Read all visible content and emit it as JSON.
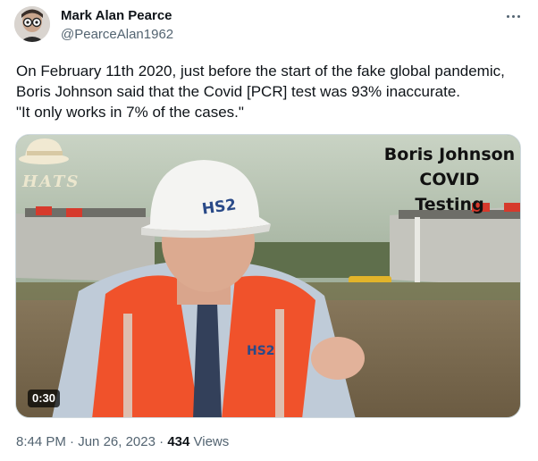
{
  "author": {
    "name": "Mark Alan Pearce",
    "handle": "@PearceAlan1962"
  },
  "tweet": {
    "lines": [
      "On February 11th 2020, just before the start of the fake global pandemic,",
      "Boris Johnson said that the Covid [PCR] test was 93% inaccurate.",
      "\"It only works in 7% of the cases.\""
    ]
  },
  "video": {
    "title_line1": "Boris Johnson",
    "title_line2": "COVID Testing",
    "watermark": "HATS",
    "helmet_text": "HS2",
    "vest_text": "HS2",
    "duration": "0:30"
  },
  "footer": {
    "time": "8:44 PM",
    "date": "Jun 26, 2023",
    "separator": "·",
    "views_count": "434",
    "views_label": "Views"
  },
  "icons": {
    "more": "more-horizontal-icon",
    "hat": "hat-logo-icon"
  },
  "colors": {
    "text_primary": "#0f1419",
    "text_secondary": "#536471",
    "vest_orange": "#f0522b"
  }
}
